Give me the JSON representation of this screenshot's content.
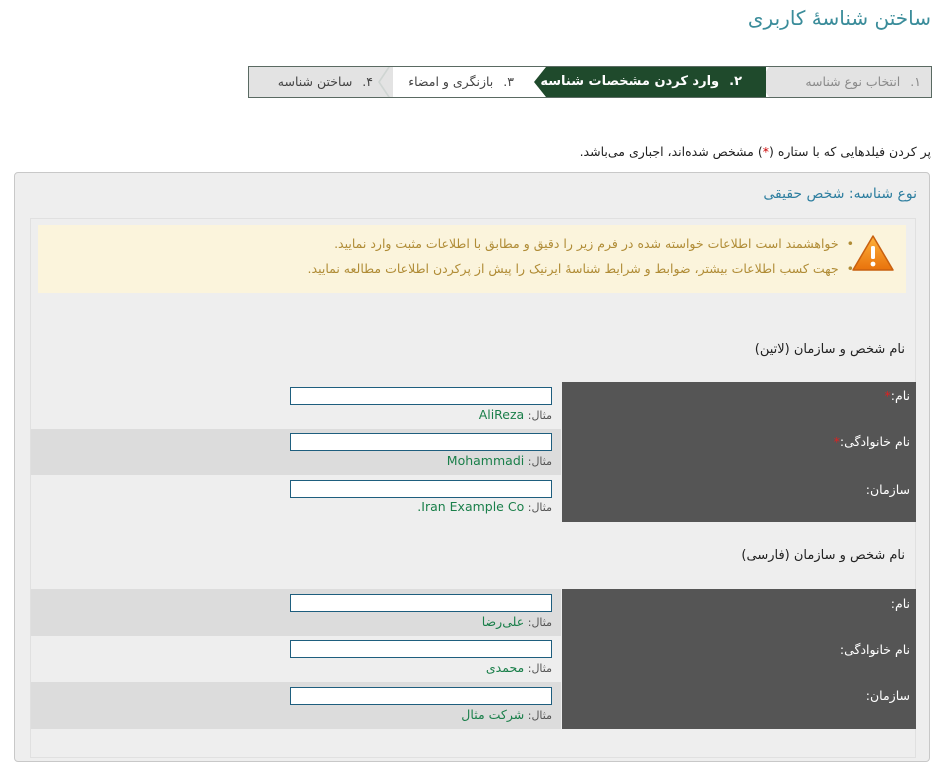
{
  "page_title": "ساختن شناسهٔ کاربری",
  "wizard": {
    "steps": [
      {
        "num": "۱.",
        "label": "انتخاب نوع شناسه"
      },
      {
        "num": "۲.",
        "label": "وارد کردن مشخصات شناسه"
      },
      {
        "num": "۳.",
        "label": "بازنگری و امضاء"
      },
      {
        "num": "۴.",
        "label": "ساختن شناسه"
      }
    ]
  },
  "required_note": {
    "before": "پر کردن فیلدهایی که با ستاره (",
    "star": "*",
    "after": ") مشخص شده‌اند، اجباری می‌باشد."
  },
  "identity_type": "نوع شناسه: شخص حقیقی",
  "warning": {
    "items": [
      "خواهشمند است اطلاعات خواسته شده در فرم زیر را دقیق و مطابق با اطلاعات مثبت وارد نمایید.",
      "جهت کسب اطلاعات بیشتر، ضوابط و شرایط شناسهٔ ایرنیک را پیش از پرکردن اطلاعات مطالعه نمایید."
    ]
  },
  "latin": {
    "heading": "نام شخص و سازمان (لاتین)",
    "fields": [
      {
        "label": "نام:",
        "required": "*",
        "value": "",
        "example_prefix": "مثال:",
        "example": "AliReza"
      },
      {
        "label": "نام خانوادگی:",
        "required": "*",
        "value": "",
        "example_prefix": "مثال:",
        "example": "Mohammadi"
      },
      {
        "label": "سازمان:",
        "required": "",
        "value": "",
        "example_prefix": "مثال:",
        "example": "Iran Example Co."
      }
    ]
  },
  "farsi": {
    "heading": "نام شخص و سازمان (فارسی)",
    "fields": [
      {
        "label": "نام:",
        "value": "",
        "example_prefix": "مثال:",
        "example": "علی‌رضا"
      },
      {
        "label": "نام خانوادگی:",
        "value": "",
        "example_prefix": "مثال:",
        "example": "محمدی"
      },
      {
        "label": "سازمان:",
        "value": "",
        "example_prefix": "مثال:",
        "example": "شرکت مثال"
      }
    ]
  },
  "colors": {
    "title": "#3a8c9a",
    "active_step": "#1f4a2c",
    "label_column": "#555555",
    "example_value": "#1a7f4a",
    "warning_text": "#b08c36",
    "warning_bg": "#fbf4dc",
    "required_star": "#e02020"
  },
  "icons": {
    "warning": "warning-triangle-icon"
  }
}
